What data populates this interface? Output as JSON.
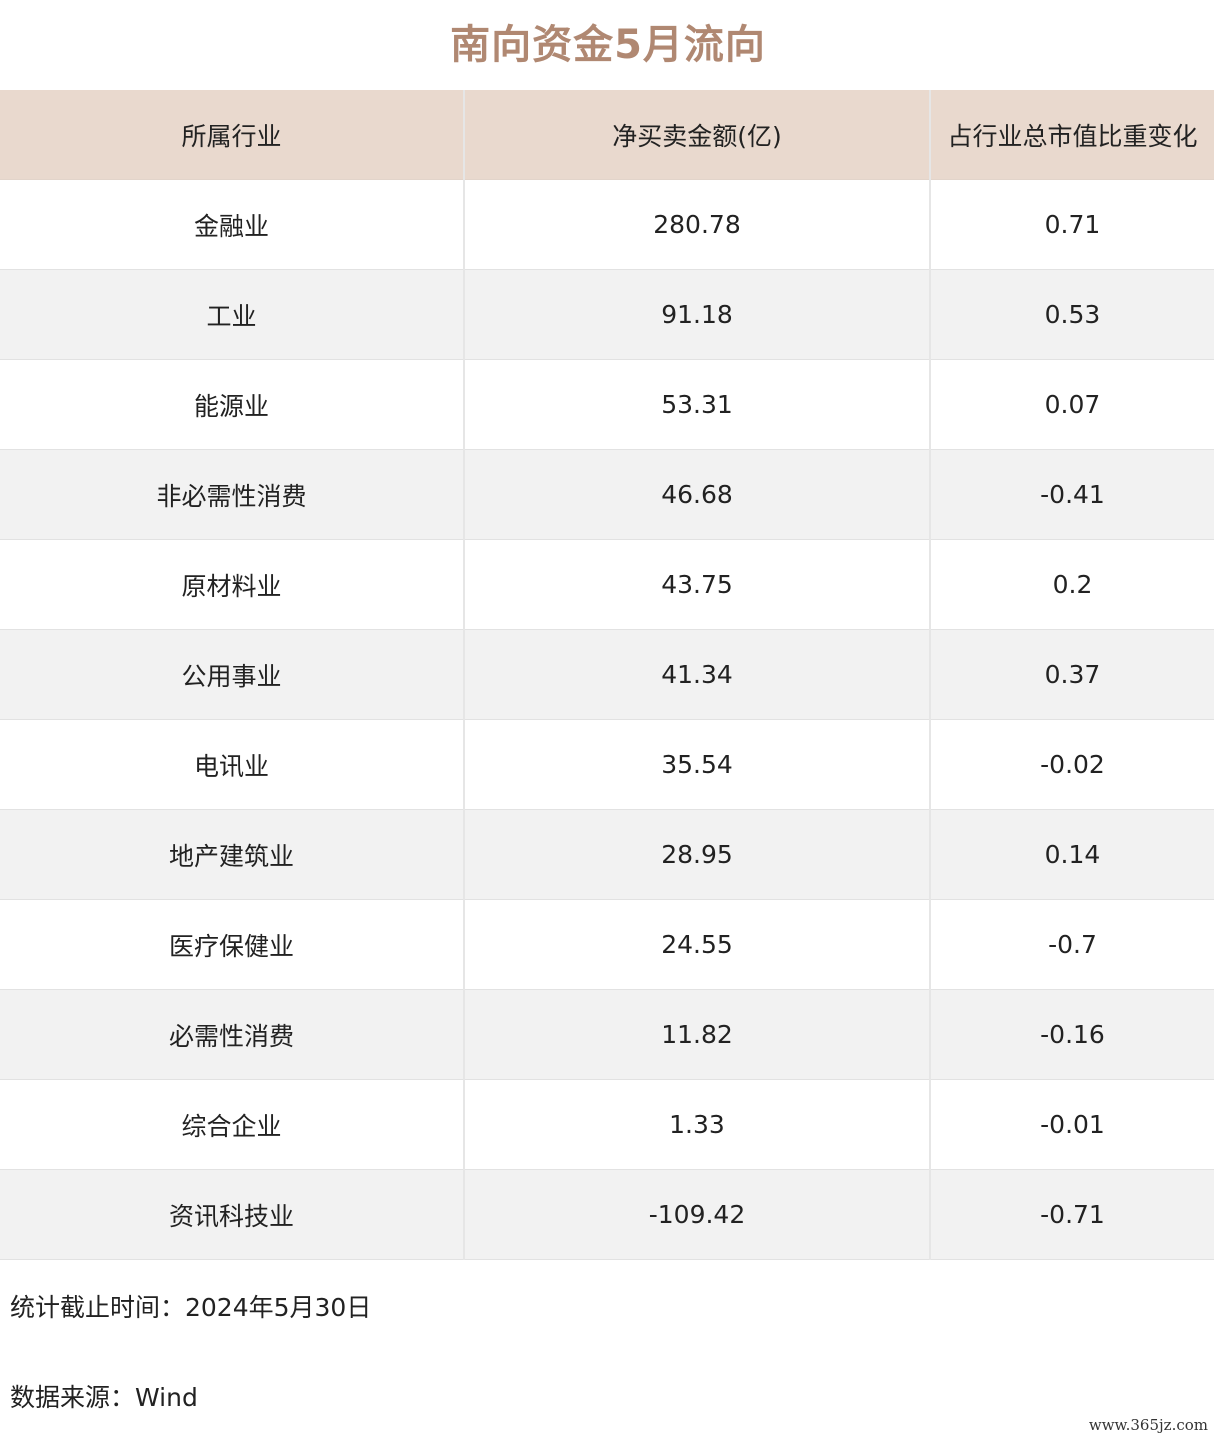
{
  "chart_data": {
    "type": "table",
    "title": "南向资金5月流向",
    "columns": [
      "所属行业",
      "净买卖金额(亿)",
      "占行业总市值比重变化"
    ],
    "rows": [
      [
        "金融业",
        "280.78",
        "0.71"
      ],
      [
        "工业",
        "91.18",
        "0.53"
      ],
      [
        "能源业",
        "53.31",
        "0.07"
      ],
      [
        "非必需性消费",
        "46.68",
        "-0.41"
      ],
      [
        "原材料业",
        "43.75",
        "0.2"
      ],
      [
        "公用事业",
        "41.34",
        "0.37"
      ],
      [
        "电讯业",
        "35.54",
        "-0.02"
      ],
      [
        "地产建筑业",
        "28.95",
        "0.14"
      ],
      [
        "医疗保健业",
        "24.55",
        "-0.7"
      ],
      [
        "必需性消费",
        "11.82",
        "-0.16"
      ],
      [
        "综合企业",
        "1.33",
        "-0.01"
      ],
      [
        "资讯科技业",
        "-109.42",
        "-0.71"
      ]
    ]
  },
  "notes": {
    "date": "统计截止时间：2024年5月30日",
    "source": "数据来源：Wind"
  },
  "watermark": "www.365jz.com",
  "colors": {
    "title": "#b08872",
    "header_bg": "#e9d9ce",
    "stripe_bg": "#f2f2f2"
  }
}
